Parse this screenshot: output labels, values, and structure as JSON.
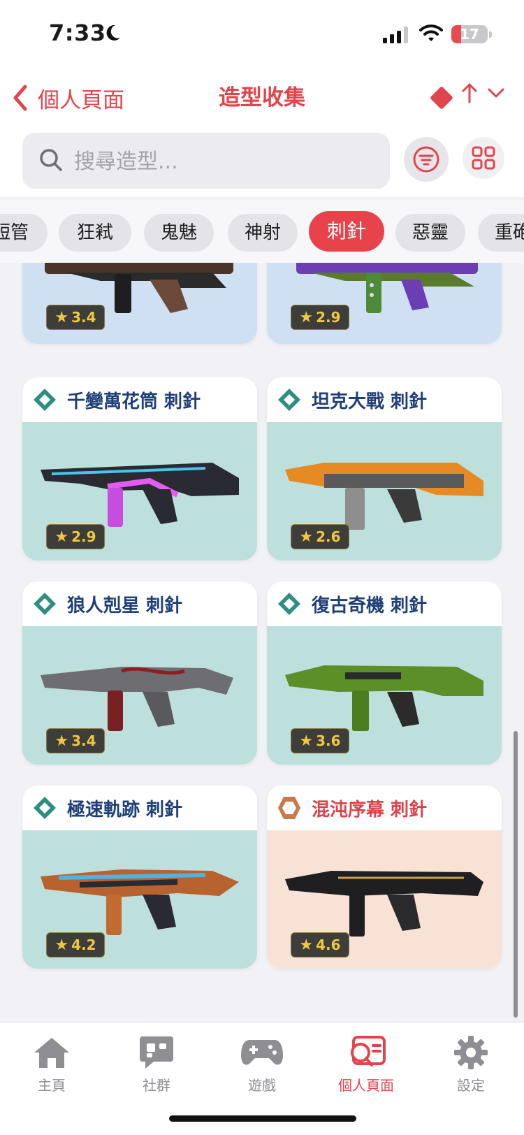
{
  "status_bar": {
    "time": "7:33",
    "battery": "17"
  },
  "nav": {
    "back_label": "個人頁面",
    "title": "造型收集"
  },
  "search": {
    "placeholder": "搜尋造型..."
  },
  "chips": [
    "短管",
    "狂弒",
    "鬼魅",
    "神射",
    "刺針",
    "惡靈",
    "重砲"
  ],
  "active_chip": "刺針",
  "cards": [
    {
      "name": "",
      "rating": "3.4"
    },
    {
      "name": "",
      "rating": "2.9"
    },
    {
      "name": "千變萬花筒 刺針",
      "rating": "2.9"
    },
    {
      "name": "坦克大戰 刺針",
      "rating": "2.6"
    },
    {
      "name": "狼人剋星 刺針",
      "rating": "3.4"
    },
    {
      "name": "復古奇機 刺針",
      "rating": "3.6"
    },
    {
      "name": "極速軌跡 刺針",
      "rating": "4.2"
    },
    {
      "name": "混沌序幕 刺針",
      "rating": "4.6"
    }
  ],
  "tabs": [
    {
      "label": "主頁",
      "icon": "home-icon"
    },
    {
      "label": "社群",
      "icon": "chat-bubble-icon"
    },
    {
      "label": "遊戲",
      "icon": "gamepad-icon"
    },
    {
      "label": "個人頁面",
      "icon": "profile-search-icon"
    },
    {
      "label": "設定",
      "icon": "gear-icon"
    }
  ],
  "active_tab": "個人頁面",
  "colors": {
    "accent": "#e2444c",
    "select_tier": "#bde0dc",
    "exclusive_tier": "#f8e2d5",
    "deluxe_tier": "#cfe0f2",
    "name_text": "#1e3f78"
  }
}
